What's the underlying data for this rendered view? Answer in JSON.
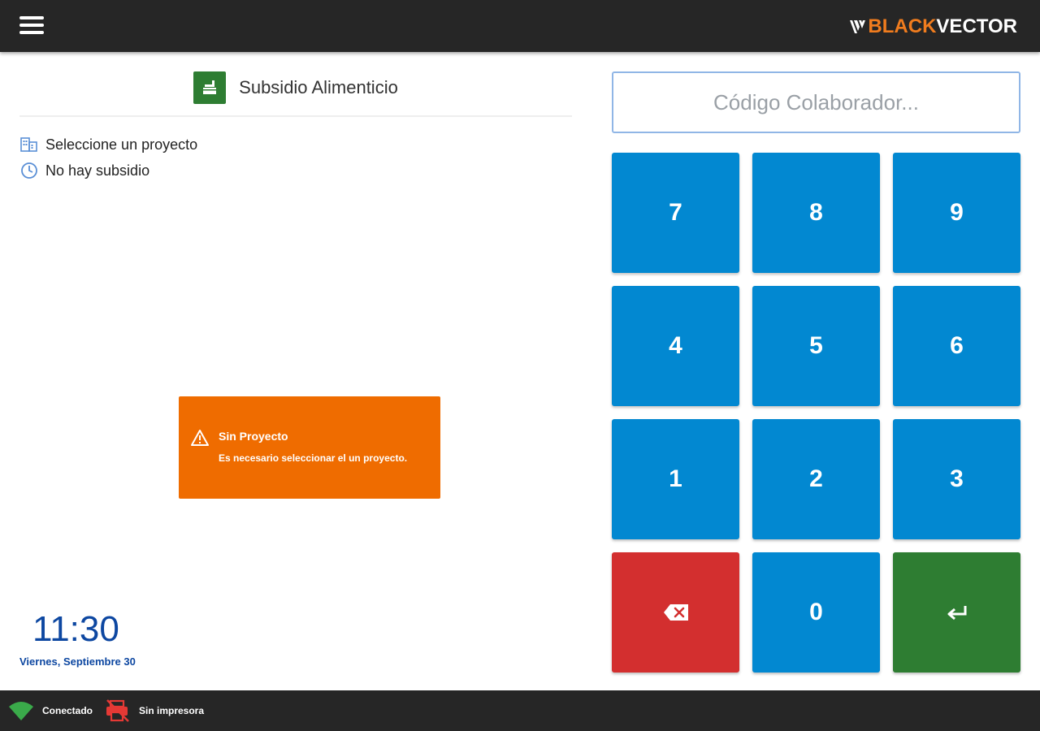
{
  "header": {
    "brand_black": "BLACK",
    "brand_vector": "VECTOR",
    "menu_icon": "hamburger-menu-icon"
  },
  "left": {
    "title": "Subsidio Alimenticio",
    "project_label": "Seleccione un proyecto",
    "subsidy_label": "No hay subsidio"
  },
  "alert": {
    "title": "Sin Proyecto",
    "message": "Es necesario seleccionar el un proyecto."
  },
  "clock": {
    "time": "11:30",
    "date": "Viernes, Septiembre 30"
  },
  "input": {
    "placeholder": "Código Colaborador..."
  },
  "keypad": {
    "rows": [
      [
        "7",
        "8",
        "9"
      ],
      [
        "4",
        "5",
        "6"
      ],
      [
        "1",
        "2",
        "3"
      ]
    ],
    "zero": "0",
    "delete_icon": "backspace-icon",
    "enter_icon": "enter-icon"
  },
  "status": {
    "wifi": "Conectado",
    "printer": "Sin impresora"
  },
  "colors": {
    "topbar": "#262626",
    "accent_orange": "#f07c1e",
    "key_blue": "#0288d1",
    "key_red": "#d32f2f",
    "key_green": "#2e7d32",
    "alert_orange": "#ef6c00",
    "clock_blue": "#0d47a1"
  }
}
